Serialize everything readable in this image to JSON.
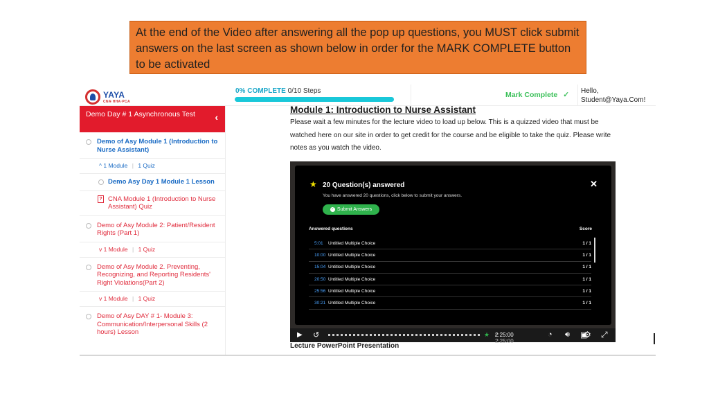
{
  "callout": {
    "text": "At the end of the Video after answering all the pop up questions, you MUST click submit answers on the last screen as shown below in order for the MARK COMPLETE button to be activated"
  },
  "header": {
    "logo_text": "YAYA",
    "logo_sub": "CNA·HHA·PCA",
    "progress_percent": "0% COMPLETE",
    "progress_steps": "0/10 Steps",
    "progress_value": 0,
    "mark_complete": "Mark Complete",
    "greeting_line1": "Hello,",
    "greeting_line2": "Student@Yaya.Com!"
  },
  "sidebar": {
    "title": "Demo Day # 1 Asynchronous Test",
    "items": [
      {
        "label": "Demo of Asy Module 1 (Introduction to Nurse Assistant)",
        "meta_lessons": "1 Module",
        "meta_quiz": "1 Quiz"
      },
      {
        "label": "Demo of Asy Module 2: Patient/Resident Rights (Part 1)",
        "meta_lessons": "1 Module",
        "meta_quiz": "1 Quiz"
      },
      {
        "label": "Demo of Asy Module 2. Preventing, Recognizing, and Reporting Residents' Right Violations(Part 2)",
        "meta_lessons": "1 Module",
        "meta_quiz": "1 Quiz"
      },
      {
        "label": "Demo of Asy DAY # 1- Module 3: Communication/Interpersonal Skills (2 hours) Lesson"
      }
    ],
    "sub_lesson": "Demo Asy Day 1 Module 1 Lesson",
    "sub_quiz": "CNA Module 1 (Introduction to Nurse Assistant) Quiz"
  },
  "main": {
    "module_title": "Module 1: Introduction to Nurse Assistant",
    "description": "Please wait a few minutes for the lecture video to load up below. This is a quizzed video that must be watched here on our site in order to get credit for the course and be eligible to take the quiz. Please write notes as you watch the video.",
    "footer_label": "Lecture PowerPoint Presentation"
  },
  "quiz_modal": {
    "title": "20 Question(s) answered",
    "subtitle": "You have answered 20 questions, click below to submit your answers.",
    "submit_label": "Submit Answers",
    "col_answered": "Answered questions",
    "col_score": "Score",
    "rows": [
      {
        "time": "5:01",
        "name": "Untitled Multiple Choice",
        "score": "1 / 1"
      },
      {
        "time": "10:00",
        "name": "Untitled Multiple Choice",
        "score": "1 / 1"
      },
      {
        "time": "15:04",
        "name": "Untitled Multiple Choice",
        "score": "1 / 1"
      },
      {
        "time": "20:50",
        "name": "Untitled Multiple Choice",
        "score": "1 / 1"
      },
      {
        "time": "25:56",
        "name": "Untitled Multiple Choice",
        "score": "1 / 1"
      },
      {
        "time": "30:21",
        "name": "Untitled Multiple Choice",
        "score": "1 / 1"
      }
    ]
  },
  "player": {
    "current_time": "2:25:00",
    "duration": "/ 2:25:00"
  },
  "colors": {
    "accent_red": "#e21b2c",
    "accent_blue": "#1a6bc4",
    "progress_cyan": "#19c8d9",
    "success_green": "#3cc05a",
    "callout_orange": "#ed7d31"
  }
}
